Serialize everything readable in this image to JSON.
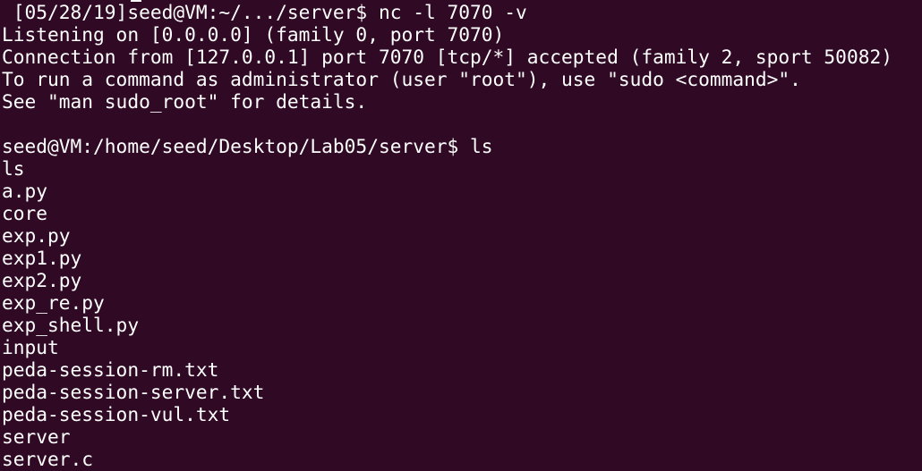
{
  "terminal": {
    "lines": [
      " [05/28/19]seed@VM:~/.../server$ nc -l 7070 -v",
      "Listening on [0.0.0.0] (family 0, port 7070)",
      "Connection from [127.0.0.1] port 7070 [tcp/*] accepted (family 2, sport 50082)",
      "To run a command as administrator (user \"root\"), use \"sudo <command>\".",
      "See \"man sudo_root\" for details.",
      "",
      "seed@VM:/home/seed/Desktop/Lab05/server$ ls",
      "ls",
      "a.py",
      "core",
      "exp.py",
      "exp1.py",
      "exp2.py",
      "exp_re.py",
      "exp_shell.py",
      "input",
      "peda-session-rm.txt",
      "peda-session-server.txt",
      "peda-session-vul.txt",
      "server",
      "server.c"
    ]
  },
  "colors": {
    "background": "#300a24",
    "text": "#ffffff"
  }
}
